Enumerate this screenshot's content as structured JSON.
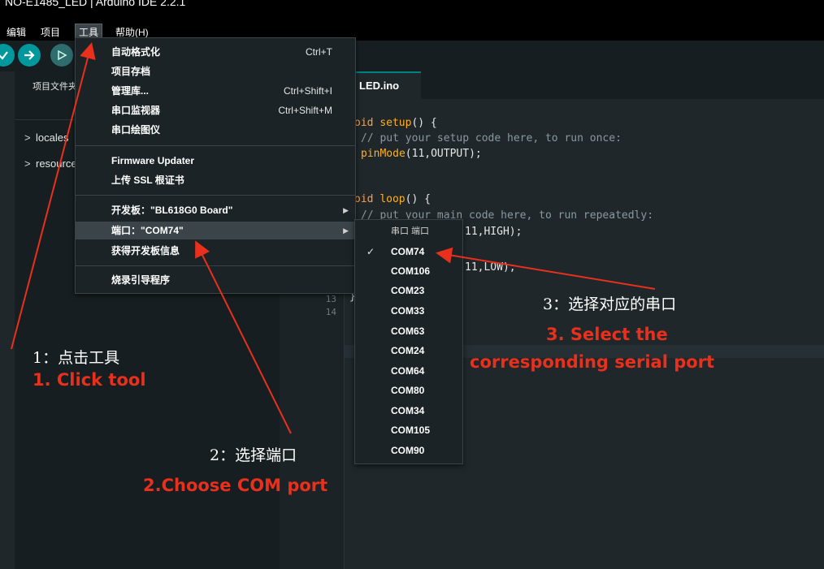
{
  "window": {
    "title": "NO-E1485_LED | Arduino IDE 2.2.1"
  },
  "menubar": {
    "items": [
      "编辑",
      "项目",
      "工具",
      "帮助(H)"
    ]
  },
  "toolbar": {
    "buttons": [
      "verify-icon",
      "upload-icon",
      "debug-icon"
    ]
  },
  "sidebar": {
    "title": "项目文件夹",
    "items": [
      {
        "chevron": ">",
        "label": "locales"
      },
      {
        "chevron": ">",
        "label": "resources"
      }
    ]
  },
  "editor": {
    "tab": "LED.ino",
    "line_numbers": [
      "13",
      "14"
    ],
    "code": [
      {
        "pre": "oid ",
        "fn": "setup",
        "post": "() {"
      },
      {
        "comment": "// put your setup code here, to run once:"
      },
      {
        "fn": "pinMode",
        "post": "(11,OUTPUT);"
      },
      {
        "pre": "oid ",
        "fn": "loop",
        "post": "() {"
      },
      {
        "comment": "// put your main code here, to run repeatedly:"
      },
      {
        "post": "11,HIGH);"
      },
      {
        "post": "11,LOW);"
      },
      {
        "post": "}"
      }
    ]
  },
  "tools_menu": {
    "items": [
      {
        "label": "自动格式化",
        "shortcut": "Ctrl+T"
      },
      {
        "label": "项目存档",
        "shortcut": ""
      },
      {
        "label": "管理库...",
        "shortcut": "Ctrl+Shift+I"
      },
      {
        "label": "串口监视器",
        "shortcut": "Ctrl+Shift+M"
      },
      {
        "label": "串口绘图仪",
        "shortcut": ""
      },
      {
        "label": "Firmware Updater",
        "shortcut": ""
      },
      {
        "label": "上传 SSL 根证书",
        "shortcut": ""
      },
      {
        "label": "开发板：\"BL618G0 Board\"",
        "shortcut": ""
      },
      {
        "label": "端口：\"COM74\"",
        "shortcut": ""
      },
      {
        "label": "获得开发板信息",
        "shortcut": ""
      },
      {
        "label": "烧录引导程序",
        "shortcut": ""
      }
    ]
  },
  "port_menu": {
    "header": "串口 端口",
    "selected": "COM74",
    "check": "✓",
    "ports": [
      "COM74",
      "COM106",
      "COM23",
      "COM33",
      "COM63",
      "COM24",
      "COM64",
      "COM80",
      "COM34",
      "COM105",
      "COM90"
    ]
  },
  "annotations": {
    "step1_cn": "1：点击工具",
    "step1_en": "1. Click tool",
    "step2_cn": "2：选择端口",
    "step2_en": "2.Choose COM port",
    "step3_cn": "3：选择对应的串口",
    "step3_en_line1": "3. Select the",
    "step3_en_line2": "corresponding serial port"
  },
  "colors": {
    "annotation_red": "#e8301c",
    "accent": "#00979d"
  }
}
